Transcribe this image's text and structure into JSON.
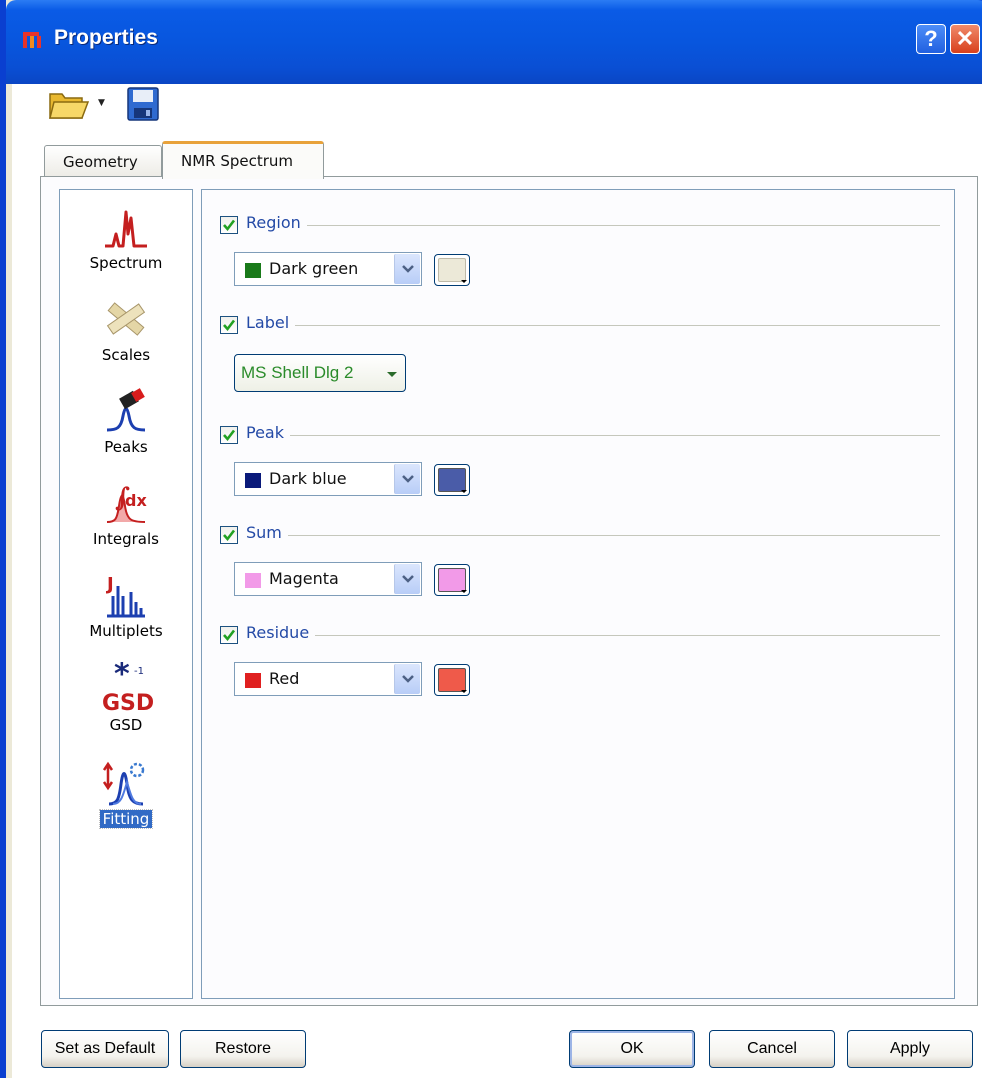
{
  "window": {
    "title": "Properties",
    "help_label": "?",
    "close_label": "✕"
  },
  "toolbar": {
    "icons": [
      "open-folder-icon",
      "dropdown-arrow-icon",
      "save-icon"
    ]
  },
  "tabs": [
    {
      "label": "Geometry",
      "active": false
    },
    {
      "label": "NMR Spectrum",
      "active": true
    }
  ],
  "categories": [
    {
      "label": "Spectrum",
      "icon": "spectrum-icon",
      "selected": false
    },
    {
      "label": "Scales",
      "icon": "scales-icon",
      "selected": false
    },
    {
      "label": "Peaks",
      "icon": "peaks-icon",
      "selected": false
    },
    {
      "label": "Integrals",
      "icon": "integrals-icon",
      "selected": false
    },
    {
      "label": "Multiplets",
      "icon": "multiplets-icon",
      "selected": false
    },
    {
      "label": "GSD",
      "icon": "gsd-icon",
      "selected": false
    },
    {
      "label": "Fitting",
      "icon": "fitting-icon",
      "selected": true
    }
  ],
  "groups": {
    "region": {
      "title": "Region",
      "checked": true,
      "color_name": "Dark green",
      "swatch": "#1a7a1a",
      "button_color": "#ece9d8"
    },
    "label": {
      "title": "Label",
      "checked": true,
      "font": "MS Shell Dlg 2"
    },
    "peak": {
      "title": "Peak",
      "checked": true,
      "color_name": "Dark blue",
      "swatch": "#0a1a7a",
      "button_color": "#4a5ca8"
    },
    "sum": {
      "title": "Sum",
      "checked": true,
      "color_name": "Magenta",
      "swatch": "#f29ae8",
      "button_color": "#f29ae8"
    },
    "residue": {
      "title": "Residue",
      "checked": true,
      "color_name": "Red",
      "swatch": "#e02020",
      "button_color": "#ef5a4a"
    }
  },
  "buttons": {
    "set_default": "Set as Default",
    "restore": "Restore",
    "ok": "OK",
    "cancel": "Cancel",
    "apply": "Apply"
  }
}
